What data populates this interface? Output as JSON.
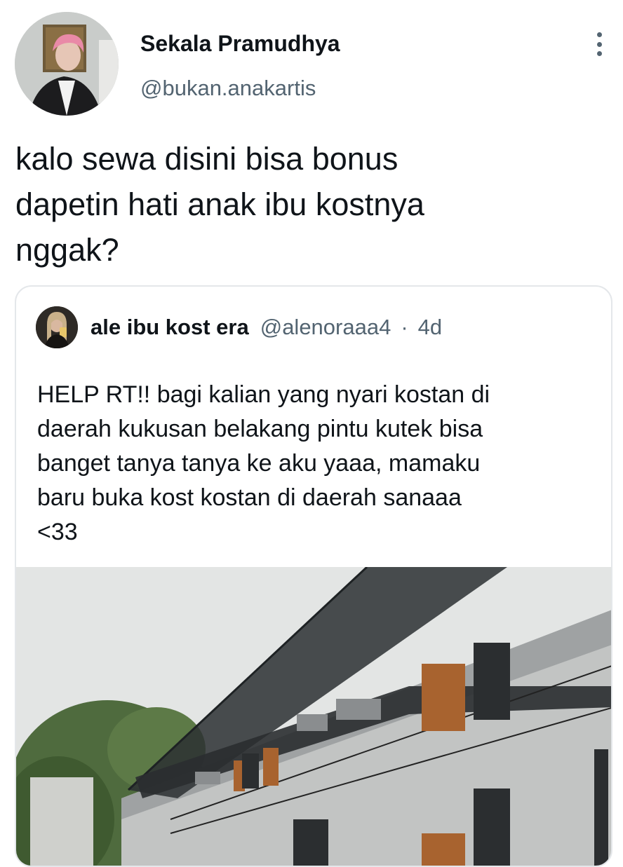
{
  "tweet": {
    "author_name": "Sekala Pramudhya",
    "author_handle": "@bukan.anakartis",
    "text": "kalo sewa disini bisa bonus\ndapetin hati anak ibu kostnya\nnggak?",
    "more_icon": "more-vertical-icon"
  },
  "quoted": {
    "author_name": "ale ibu kost era",
    "author_handle": "@alenoraaa4",
    "separator": "·",
    "time": "4d",
    "text": "HELP RT!! bagi kalian yang nyari kostan di\ndaerah kukusan belakang pintu kutek bisa\nbanget tanya tanya ke aku yaaa, mamaku\nbaru buka kost kostan di daerah sanaaa\n<33"
  },
  "colors": {
    "text_primary": "#0f1419",
    "text_secondary": "#536471",
    "border": "#e4e7ea"
  }
}
